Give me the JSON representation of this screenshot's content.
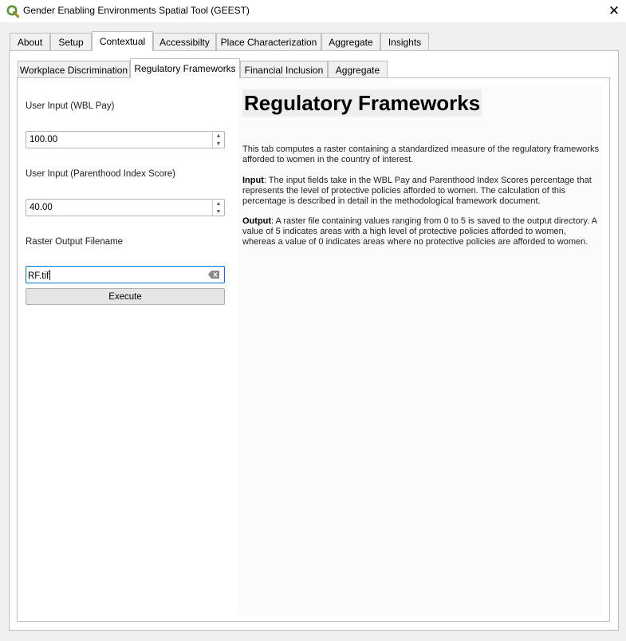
{
  "window": {
    "title": "Gender Enabling Environments Spatial Tool (GEEST)",
    "close_glyph": "✕",
    "logo_icon": "qgis-logo-icon",
    "logo_color": "#589632"
  },
  "main_tabs": [
    {
      "label": "About"
    },
    {
      "label": "Setup"
    },
    {
      "label": "Contextual",
      "active": true
    },
    {
      "label": "Accessibilty"
    },
    {
      "label": "Place Characterization"
    },
    {
      "label": "Aggregate"
    },
    {
      "label": "Insights"
    }
  ],
  "sub_tabs": [
    {
      "label": "Workplace Discrimination"
    },
    {
      "label": "Regulatory Frameworks",
      "active": true
    },
    {
      "label": "Financial Inclusion"
    },
    {
      "label": "Aggregate"
    }
  ],
  "form": {
    "wbl_pay_label": "User Input (WBL Pay)",
    "wbl_pay_value": "100.00",
    "parenthood_label": "User Input (Parenthood Index Score)",
    "parenthood_value": "40.00",
    "output_label": "Raster Output Filename",
    "output_value": "RF.tif",
    "execute_label": "Execute"
  },
  "doc": {
    "title": "Regulatory Frameworks",
    "intro": "This tab computes a raster containing a standardized measure of the regulatory frameworks afforded to women in the country of interest.",
    "input_heading": "Input",
    "input_text": ": The input fields take in the WBL Pay and Parenthood Index Scores percentage that represents the level of protective policies afforded to women. The calculation of this percentage is described in detail in the methodological framework document.",
    "output_heading": "Output",
    "output_text": ": A raster file containing values ranging from 0 to 5 is saved to the output directory. A value of 5 indicates areas with a high level of protective policies afforded to women, whereas a value of 0 indicates areas where no protective policies are afforded to women."
  }
}
